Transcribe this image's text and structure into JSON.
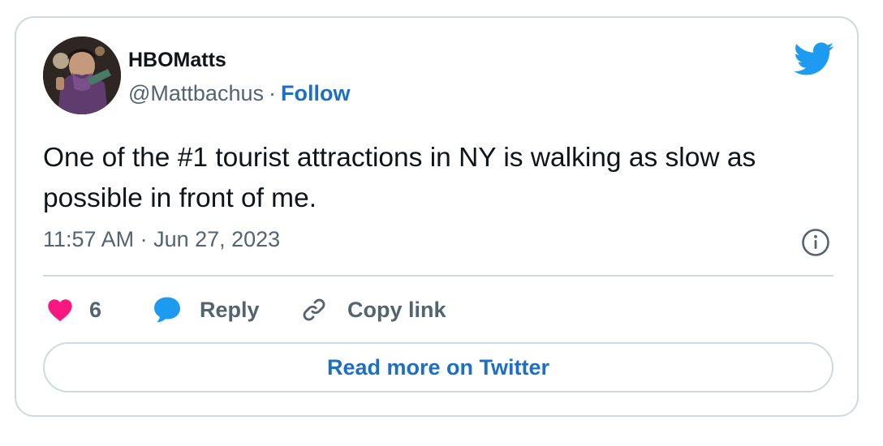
{
  "author": {
    "display_name": "HBOMatts",
    "handle": "@Mattbachus",
    "separator": "·",
    "follow_label": "Follow",
    "avatar_icon": "user-avatar-photo"
  },
  "tweet": {
    "text": "One of the #1 tourist attractions in NY is walking as slow as possible in front of me.",
    "timestamp": "11:57 AM · Jun 27, 2023"
  },
  "actions": {
    "like_count": "6",
    "reply_label": "Reply",
    "copy_label": "Copy link",
    "read_more_label": "Read more on Twitter"
  },
  "icons": {
    "brand": "twitter-bird-icon",
    "info": "info-icon",
    "like": "heart-icon",
    "reply": "speech-bubble-icon",
    "copy": "link-icon"
  },
  "colors": {
    "brand_blue": "#1d9bf0",
    "link_blue": "#1d6fc4",
    "like_pink": "#f91880",
    "text": "#0f1419",
    "muted": "#536471",
    "border": "#cfd9de"
  }
}
